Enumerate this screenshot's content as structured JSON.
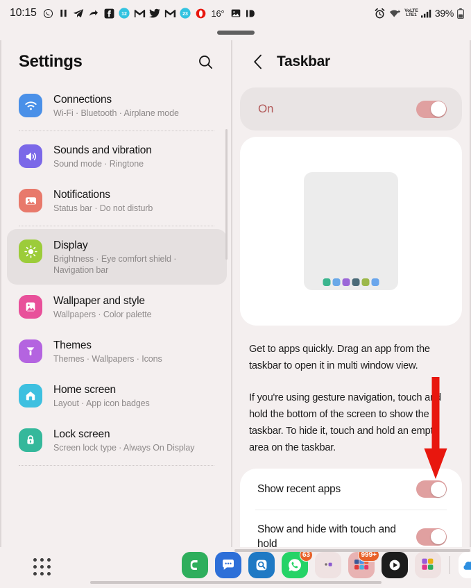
{
  "status_bar": {
    "clock": "10:15",
    "left_icons": [
      {
        "name": "whatsapp-icon",
        "glyph": "◷"
      },
      {
        "name": "pause-icon",
        "glyph": "❚❚"
      },
      {
        "name": "telegram-icon",
        "glyph": "➤"
      },
      {
        "name": "share-icon",
        "glyph": "↰"
      },
      {
        "name": "facebook-icon",
        "glyph": "f"
      },
      {
        "name": "messenger-badge-icon",
        "glyph": "12"
      },
      {
        "name": "gmail-icon",
        "glyph": "M"
      },
      {
        "name": "twitter-icon",
        "glyph": "t"
      },
      {
        "name": "gmail-second-icon",
        "glyph": "M"
      },
      {
        "name": "messenger-badge2-icon",
        "glyph": "23"
      },
      {
        "name": "opera-icon",
        "glyph": "O"
      }
    ],
    "temperature": "16°",
    "photo_icon": "photo-icon",
    "id-card_icon": "id-icon",
    "alarm_icon": "alarm-icon",
    "wifi_icon": "wifi-icon",
    "volte_label": "VoLTE",
    "network_label": "LTE1",
    "signal_icon": "signal-bars-icon",
    "battery_percent": "39%",
    "battery_icon": "battery-icon"
  },
  "left_pane": {
    "title": "Settings",
    "search_icon": "search-icon",
    "items": [
      {
        "title": "Connections",
        "subtitle": "Wi-Fi  ·  Bluetooth  ·  Airplane mode",
        "icon": "wifi-icon",
        "color": "#4a90e8",
        "selected": false
      },
      {
        "title": "Sounds and vibration",
        "subtitle": "Sound mode  ·  Ringtone",
        "icon": "speaker-icon",
        "color": "#7b68e8",
        "selected": false
      },
      {
        "title": "Notifications",
        "subtitle": "Status bar  ·  Do not disturb",
        "icon": "notification-icon",
        "color": "#e8796b",
        "selected": false
      },
      {
        "title": "Display",
        "subtitle": "Brightness  ·  Eye comfort shield  ·  Navigation bar",
        "icon": "brightness-icon",
        "color": "#9ccc3a",
        "selected": true
      },
      {
        "title": "Wallpaper and style",
        "subtitle": "Wallpapers  ·  Color palette",
        "icon": "image-icon",
        "color": "#e8509a",
        "selected": false
      },
      {
        "title": "Themes",
        "subtitle": "Themes  ·  Wallpapers  ·  Icons",
        "icon": "brush-icon",
        "color": "#b464e0",
        "selected": false
      },
      {
        "title": "Home screen",
        "subtitle": "Layout  ·  App icon badges",
        "icon": "home-icon",
        "color": "#3ec0e0",
        "selected": false
      },
      {
        "title": "Lock screen",
        "subtitle": "Screen lock type  ·  Always On Display",
        "icon": "lock-icon",
        "color": "#35b89b",
        "selected": false
      }
    ]
  },
  "right_pane": {
    "back_icon": "back-chevron-icon",
    "title": "Taskbar",
    "master_switch": {
      "label": "On",
      "state": "on",
      "accent": "#e0a0a0",
      "label_color": "#b35c5c"
    },
    "preview": {
      "dock_colors": [
        "#3bb58e",
        "#69a8e8",
        "#9b68d8",
        "#4b6b78",
        "#9cb84a",
        "#6aa6ec"
      ]
    },
    "description": [
      "Get to apps quickly. Drag an app from the taskbar to open it in multi window view.",
      "If you're using gesture navigation, touch and hold the bottom of the screen to show the taskbar. To hide it, touch and hold an empty area on the taskbar."
    ],
    "options": [
      {
        "label": "Show recent apps",
        "state": "on"
      },
      {
        "label": "Show and hide with touch and hold",
        "state": "on"
      }
    ],
    "annotation": {
      "type": "red-arrow",
      "color": "#e8170e"
    }
  },
  "dock": {
    "apps_button": "app-drawer-icon",
    "items": [
      {
        "name": "phone-app-icon",
        "glyph": "C",
        "bg": "#2eae5c",
        "badge": null
      },
      {
        "name": "messages-app-icon",
        "glyph": "···",
        "bg": "#2d6fd8",
        "badge": null
      },
      {
        "name": "finder-app-icon",
        "glyph": "Q",
        "bg": "#1f79c4",
        "badge": null
      },
      {
        "name": "whatsapp-app-icon",
        "glyph": "✆",
        "bg": "#25d366",
        "badge": "63"
      },
      {
        "name": "recent-app-1-icon",
        "glyph": "",
        "bg": "#efe2e2",
        "badge": null
      },
      {
        "name": "recent-app-2-icon",
        "glyph": "",
        "bg": "#e8b3b3",
        "badge": "999+"
      },
      {
        "name": "recent-app-3-icon",
        "glyph": "▶",
        "bg": "#1c1c1c",
        "badge": null
      },
      {
        "name": "recent-app-4-icon",
        "glyph": "",
        "bg": "#efe2e2",
        "badge": null
      },
      {
        "name": "onedrive-app-icon",
        "glyph": "☁",
        "bg": "#ffffff",
        "badge": null
      }
    ]
  }
}
